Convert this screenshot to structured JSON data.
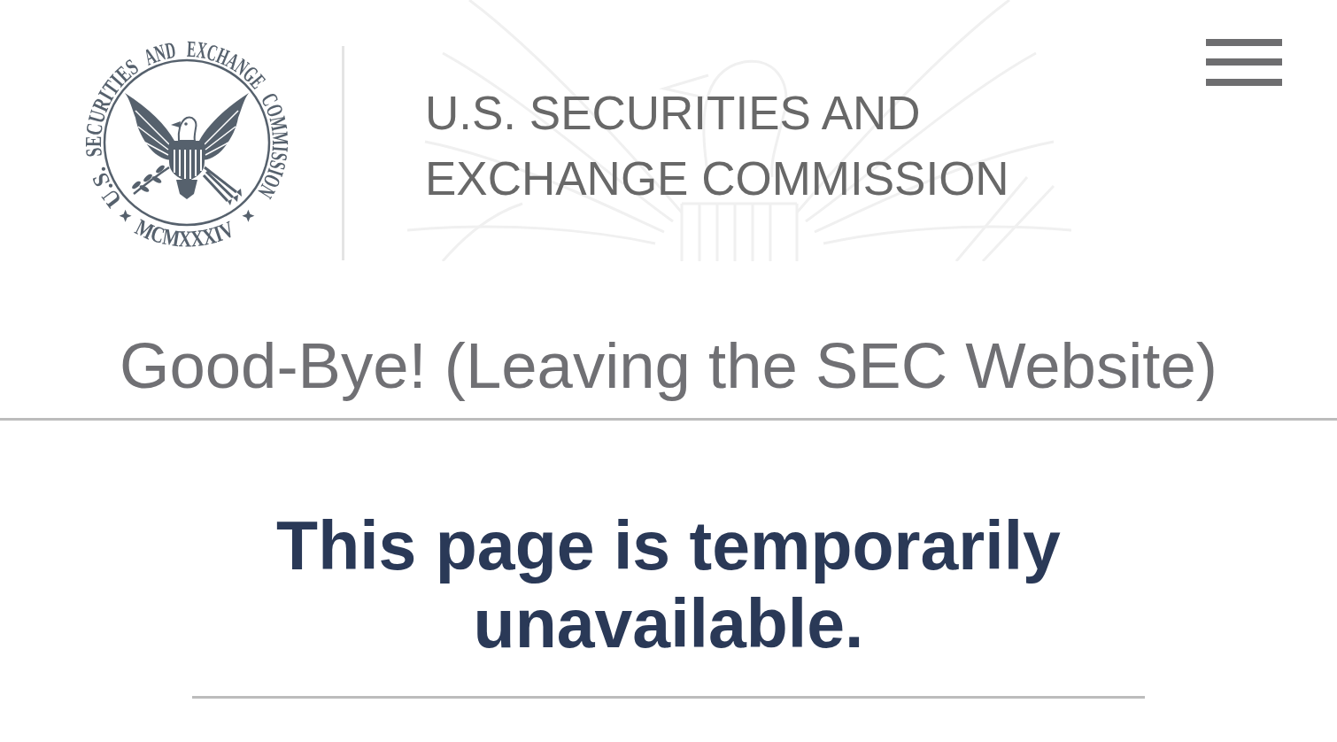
{
  "header": {
    "seal": {
      "ring_text": [
        "U.S.",
        "SECURITIES",
        "AND",
        "EXCHANGE",
        "COMMISSION"
      ],
      "year": "MCMXXXIV"
    },
    "title": "U.S. SECURITIES AND EXCHANGE COMMISSION"
  },
  "notice": {
    "heading": "Good-Bye! (Leaving the SEC Website)",
    "message": "This page is temporarily unavailable."
  }
}
